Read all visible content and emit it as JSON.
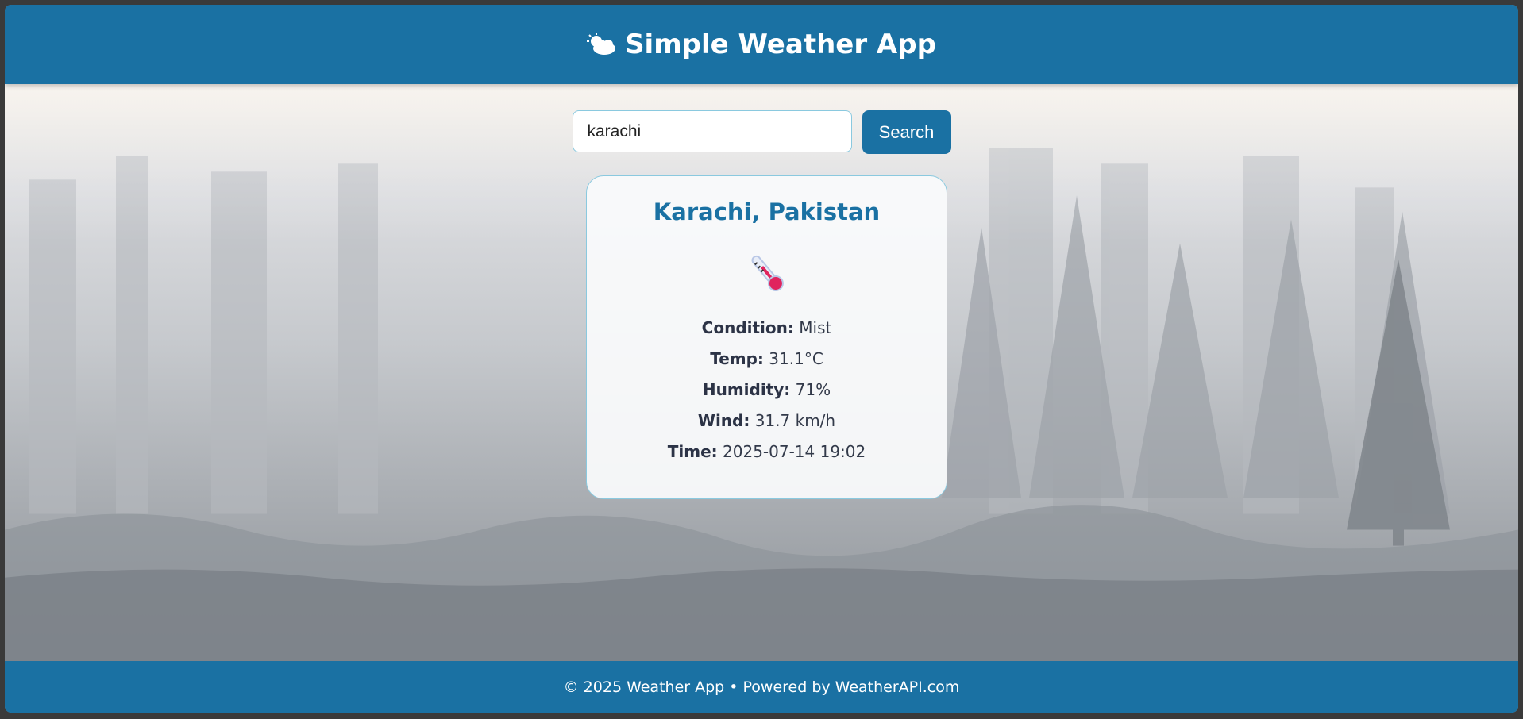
{
  "header": {
    "title": "Simple Weather App",
    "icon": "sun-behind-cloud-icon"
  },
  "search": {
    "value": "karachi",
    "button_label": "Search"
  },
  "card": {
    "location": "Karachi, Pakistan",
    "icon": "thermometer-icon",
    "condition_label": "Condition:",
    "condition_value": "Mist",
    "temp_label": "Temp:",
    "temp_value": "31.1°C",
    "humidity_label": "Humidity:",
    "humidity_value": "71%",
    "wind_label": "Wind:",
    "wind_value": "31.7 km/h",
    "time_label": "Time:",
    "time_value": "2025-07-14 19:02"
  },
  "footer": {
    "text": "© 2025 Weather App • Powered by WeatherAPI.com"
  },
  "colors": {
    "brand": "#1a71a3",
    "card_border": "#8ac9df",
    "text_dark": "#2c3346"
  }
}
